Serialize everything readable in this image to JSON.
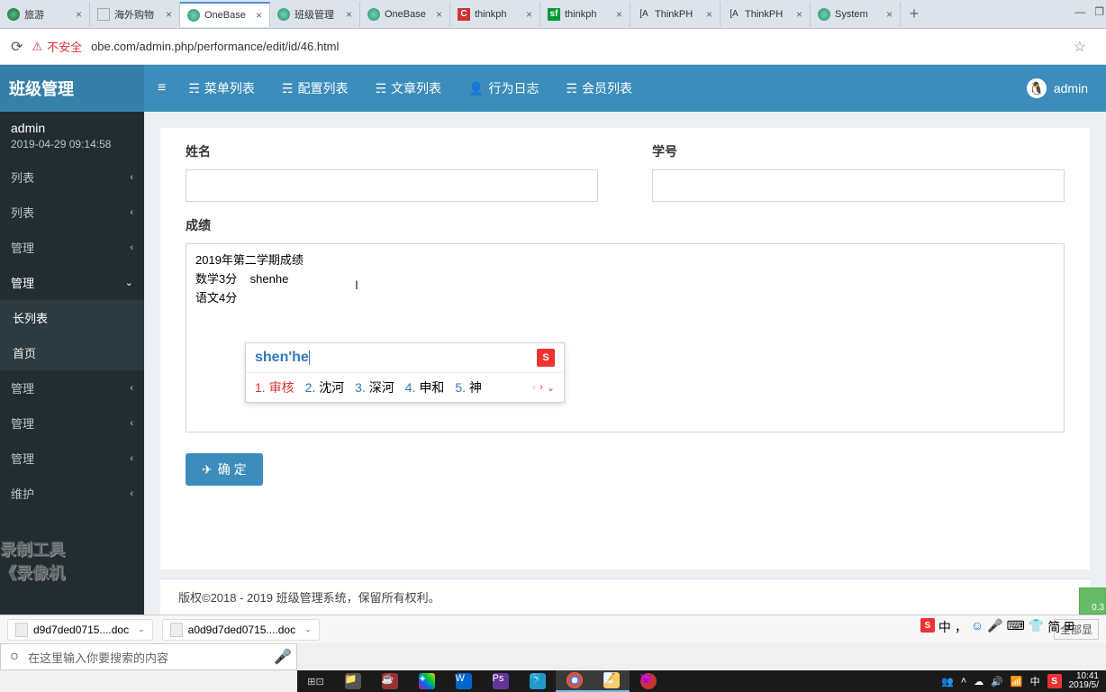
{
  "browser_tabs": [
    {
      "title": "旅游",
      "icon": "earth"
    },
    {
      "title": "海外购物",
      "icon": "page"
    },
    {
      "title": "OneBase",
      "icon": "onebase",
      "active": true
    },
    {
      "title": "班级管理",
      "icon": "onebase"
    },
    {
      "title": "OneBase",
      "icon": "onebase"
    },
    {
      "title": "thinkph",
      "icon": "red",
      "icon_text": "C"
    },
    {
      "title": "thinkph",
      "icon": "sf",
      "icon_text": "sf"
    },
    {
      "title": "ThinkPH",
      "icon": "tp",
      "icon_text": "[A"
    },
    {
      "title": "ThinkPH",
      "icon": "tp",
      "icon_text": "[A"
    },
    {
      "title": "System",
      "icon": "onebase"
    }
  ],
  "address_bar": {
    "insecure_label": "不安全",
    "url": "obe.com/admin.php/performance/edit/id/46.html"
  },
  "header": {
    "logo": "班级管理",
    "top_nav": [
      "菜单列表",
      "配置列表",
      "文章列表",
      "行为日志",
      "会员列表"
    ],
    "user_label": "admin"
  },
  "sidebar": {
    "user": {
      "name": "admin",
      "time": "2019-04-29 09:14:58"
    },
    "items": [
      {
        "label": "列表"
      },
      {
        "label": "列表"
      },
      {
        "label": "管理"
      },
      {
        "label": "管理",
        "open": true
      },
      {
        "label": "长列表",
        "sub": true,
        "highlight": true
      },
      {
        "label": "首页",
        "sub": true
      },
      {
        "label": "管理"
      },
      {
        "label": "管理"
      },
      {
        "label": "管理"
      },
      {
        "label": "维护"
      }
    ],
    "watermark_line1": "录制工具",
    "watermark_line2": "《录像机"
  },
  "form": {
    "name_label": "姓名",
    "number_label": "学号",
    "score_label": "成绩",
    "textarea_value": "2019年第二学期成绩\n数学3分    shenhe\n语文4分",
    "submit_label": "确 定"
  },
  "ime": {
    "typing": "shen'he",
    "logo_text": "S",
    "candidates": [
      {
        "num": "1.",
        "word": "审核"
      },
      {
        "num": "2.",
        "word": "沈河"
      },
      {
        "num": "3.",
        "word": "深河"
      },
      {
        "num": "4.",
        "word": "申和"
      },
      {
        "num": "5.",
        "word": "神"
      }
    ]
  },
  "footer": {
    "text": "版权©2018 - 2019 班级管理系统，保留所有权利。",
    "corner_value": "0.3"
  },
  "downloads": {
    "file1": "d9d7ded0715....doc",
    "file2": "a0d9d7ded0715....doc",
    "showall": "全部显"
  },
  "sogou_tray": {
    "logo": "S",
    "lang": "中",
    "punct": "，",
    "simp": "简"
  },
  "search_placeholder": "在这里输入你要搜索的内容",
  "taskbar": {
    "clock_time": "10:41",
    "clock_date": "2019/5/",
    "lang": "中"
  }
}
